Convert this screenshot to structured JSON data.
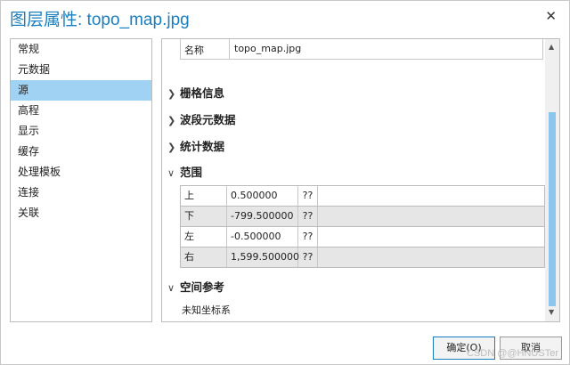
{
  "dialog": {
    "title": "图层属性: topo_map.jpg",
    "close_glyph": "✕"
  },
  "nav": {
    "items": [
      "常规",
      "元数据",
      "源",
      "高程",
      "显示",
      "缓存",
      "处理模板",
      "连接",
      "关联"
    ],
    "selected_index": 2
  },
  "source": {
    "name_label": "名称",
    "name_value": "topo_map.jpg",
    "sections": {
      "raster_info": "栅格信息",
      "band_metadata": "波段元数据",
      "statistics": "统计数据",
      "extent": "范围",
      "spatial_ref": "空间参考"
    },
    "extent_rows": [
      {
        "label": "上",
        "value": "0.500000",
        "unit": "??"
      },
      {
        "label": "下",
        "value": "-799.500000",
        "unit": "??"
      },
      {
        "label": "左",
        "value": "-0.500000",
        "unit": "??"
      },
      {
        "label": "右",
        "value": "1,599.500000",
        "unit": "??"
      }
    ],
    "spatial_ref_value": "未知坐标系"
  },
  "buttons": {
    "ok": "确定(O)",
    "cancel": "取消"
  },
  "watermark": "CSDN @@HNUSTer"
}
